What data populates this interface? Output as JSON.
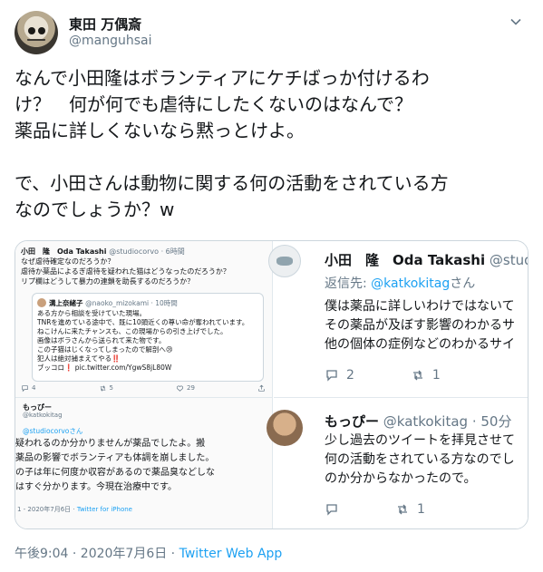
{
  "author": {
    "display_name": "東田 万偶斎",
    "handle": "@manguhsai",
    "avatar_icon": "skull-avatar-icon"
  },
  "menu_icon": "chevron-down-icon",
  "tweet": {
    "line1": "なんで小田隆はボランティアにケチばっか付けるわ",
    "line2": "け？　何が何でも虐待にしたくないのはなんで？",
    "line3": "薬品に詳しくないなら黙っとけよ。",
    "line4": "で、小田さんは動物に関する何の活動をされている方",
    "line5": "なのでしょうか？w"
  },
  "media": {
    "left": {
      "top_name": "小田　隆　Oda Takashi",
      "top_meta": "@studiocorvo · 6時間",
      "top_body": "なぜ虐待確定なのだろうか？\n虐待か薬品によるぎ虐待を疑われた猫はどうなったのだろうか？\nリプ欄はどうして暴力の連鎖を助長するのだろうか？",
      "quote_name": "溝上奈緒子",
      "quote_meta": "@naoko_mizokami · 10時間",
      "quote_body": "ある方から相談を受けていた現場。\nTNRを進めている途中で、既に10頭近くの尊い命が奪われています。\nねこけんに来たチャンスも、この現場からの引き上げでした。\n画像はボラさんから送られて来た物です。\nこの子猫はじくなってしまったので解剖へ😢\n犯人は絶対捕まえてやる‼️\nブッコロ❗️ pic.twitter.com/YgwS8jL80W",
      "actions": {
        "reply": "4",
        "retweet": "5",
        "like": "29"
      },
      "bottom_name": "もっぴー",
      "bottom_handle": "@katkokitag",
      "bottom_reply": "@studiocorvoさん",
      "bottom_body": "疑われるのか分かりませんが薬品でしたよ。搬\n薬品の影響でボランティアも体調を崩しました。\nの子は年に何度か収容があるので薬品臭などしな\nはすぐ分かります。今現在治療中です。",
      "bottom_date": "1 - 2020年7月6日 · ",
      "bottom_source": "Twitter for iPhone"
    },
    "right": {
      "name1": "小田　隆　Oda Takashi",
      "handle1": " @studio",
      "reply_prefix": "返信先: ",
      "reply_handle": "@katkokitag",
      "reply_suffix": "さん",
      "body1": "僕は薬品に詳しいわけではないて\nその薬品が及ぼす影響のわかるサ\n他の個体の症例などのわかるサイ",
      "reply_count1": "2",
      "retweet_count1": "1",
      "name2": "もっぴー",
      "meta2": " @katkokitag · 50分",
      "body2": "少し過去のツイートを拝見させて\n何の活動をされている方なのでし\nのか分からなかったので。",
      "retweet_count2": "1"
    }
  },
  "footer": {
    "time": "午後9:04 · 2020年7月6日 · ",
    "source": "Twitter Web App"
  }
}
